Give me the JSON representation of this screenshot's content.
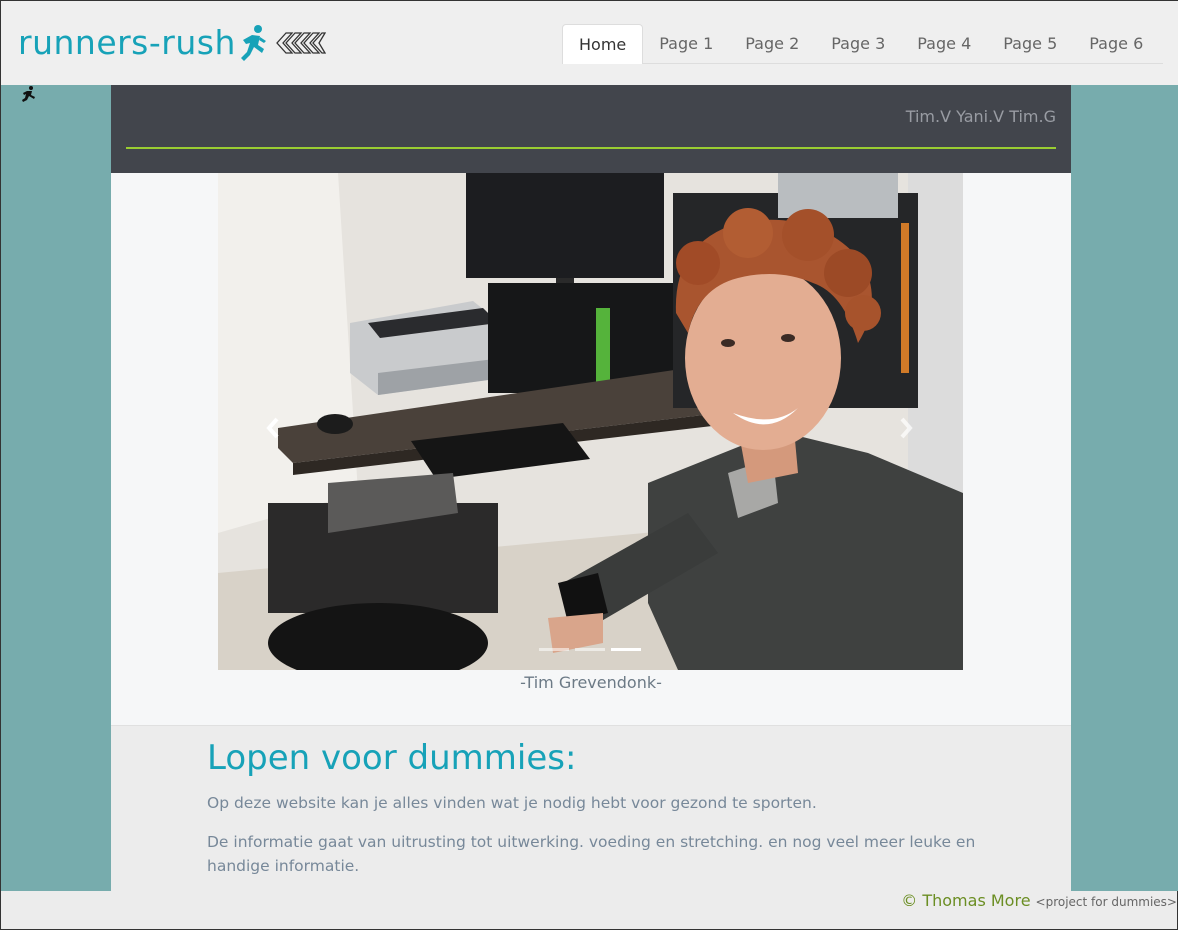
{
  "brand": {
    "name": "runners-rush",
    "color": "#17a2b8"
  },
  "nav": {
    "items": [
      {
        "label": "Home",
        "active": true
      },
      {
        "label": "Page 1"
      },
      {
        "label": "Page 2"
      },
      {
        "label": "Page 3"
      },
      {
        "label": "Page 4"
      },
      {
        "label": "Page 5"
      },
      {
        "label": "Page 6"
      }
    ]
  },
  "band": {
    "authors": "Tim.V Yani.V Tim.G",
    "accent": "#9acd32"
  },
  "carousel": {
    "caption": "-Tim Grevendonk-",
    "slide_count": 3,
    "active_slide": 3,
    "prev_icon": "chevron-left-icon",
    "next_icon": "chevron-right-icon"
  },
  "content": {
    "title": "Lopen voor dummies:",
    "paragraph1": "Op deze website kan je alles vinden wat je nodig hebt voor gezond te sporten.",
    "paragraph2": "De informatie gaat van uitrusting tot uitwerking. voeding en stretching. en nog veel meer leuke en handige informatie."
  },
  "footer": {
    "copyright": "© Thomas More",
    "note": "<project for dummies>"
  },
  "colors": {
    "teal_panel": "#77acad",
    "dark_band": "#42454c"
  }
}
